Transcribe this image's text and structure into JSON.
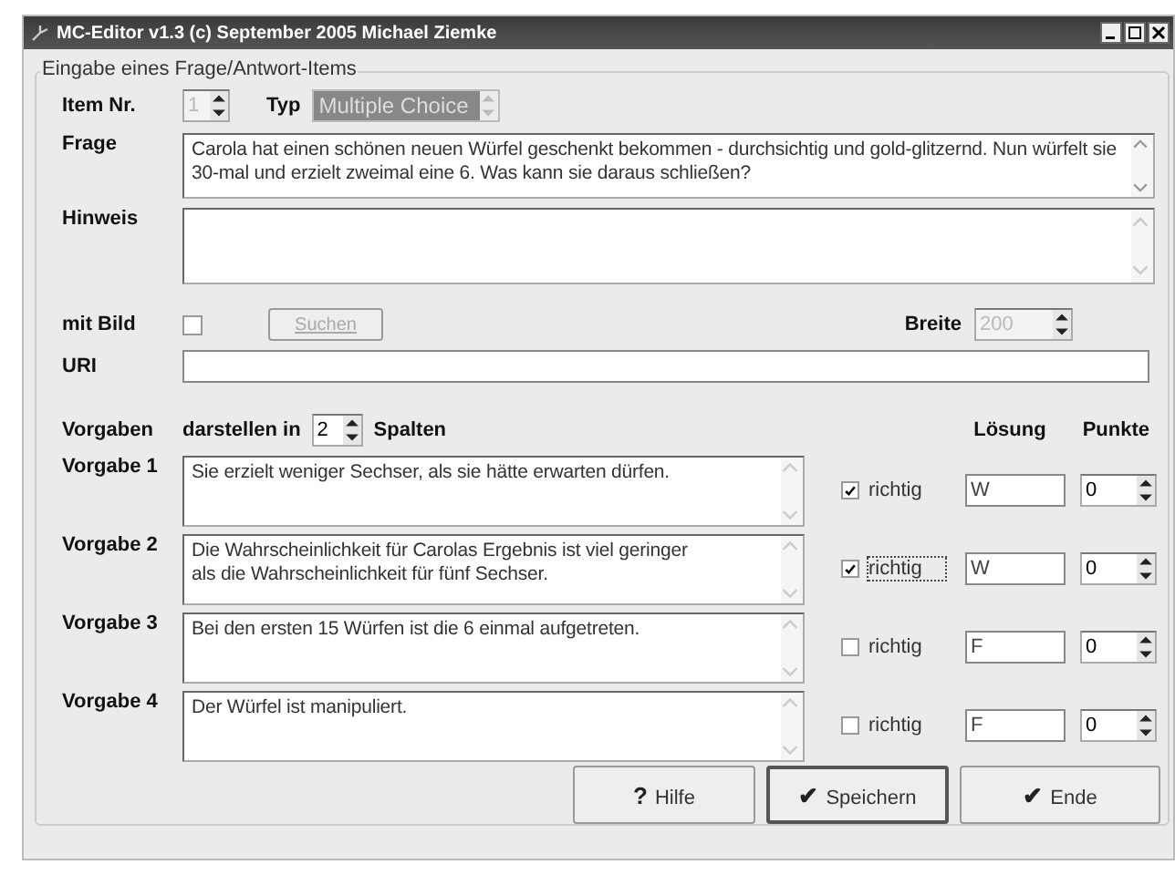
{
  "window": {
    "title": "MC-Editor v1.3 (c) September 2005 Michael Ziemke"
  },
  "group_title": "Eingabe eines Frage/Antwort-Items",
  "item_nr": {
    "label": "Item Nr.",
    "value": "1",
    "disabled": true
  },
  "typ": {
    "label": "Typ",
    "value": "Multiple Choice",
    "disabled": true
  },
  "frage": {
    "label": "Frage",
    "value": "Carola hat einen schönen neuen Würfel geschenkt bekommen - durchsichtig und gold-glitzernd. Nun würfelt sie 30-mal und erzielt zweimal eine 6. Was kann sie daraus schließen?"
  },
  "hinweis": {
    "label": "Hinweis"
  },
  "mit_bild": {
    "label": "mit Bild",
    "checked": false
  },
  "suchen_button": {
    "label": "Suchen",
    "disabled": true
  },
  "breite": {
    "label": "Breite",
    "value": "200",
    "disabled": true
  },
  "uri": {
    "label": "URI"
  },
  "vorgaben_header": {
    "label": "Vorgaben",
    "prefix": "darstellen in",
    "columns": "2",
    "suffix": "Spalten",
    "loesung": "Lösung",
    "punkte": "Punkte"
  },
  "vorgaben": [
    {
      "label": "Vorgabe 1",
      "text": "Sie erzielt weniger Sechser, als sie hätte erwarten dürfen.",
      "richtig_label": "richtig",
      "checked": true,
      "focused": false,
      "loesung": "W",
      "punkte": "0"
    },
    {
      "label": "Vorgabe 2",
      "text": "Die Wahrscheinlichkeit für Carolas Ergebnis ist viel geringer als die Wahrscheinlichkeit  für fünf Sechser.",
      "richtig_label": "richtig",
      "checked": true,
      "focused": true,
      "loesung": "W",
      "punkte": "0"
    },
    {
      "label": "Vorgabe 3",
      "text": "Bei den ersten 15 Würfen ist die 6 einmal aufgetreten.",
      "richtig_label": "richtig",
      "checked": false,
      "focused": false,
      "loesung": "F",
      "punkte": "0"
    },
    {
      "label": "Vorgabe 4",
      "text": "Der Würfel ist manipuliert.",
      "richtig_label": "richtig",
      "checked": false,
      "focused": false,
      "loesung": "F",
      "punkte": "0"
    }
  ],
  "buttons": [
    {
      "icon": "?",
      "label": "Hilfe",
      "default": false
    },
    {
      "icon": "✔",
      "label": "Speichern",
      "default": true
    },
    {
      "icon": "✔",
      "label": "Ende",
      "default": false
    }
  ]
}
